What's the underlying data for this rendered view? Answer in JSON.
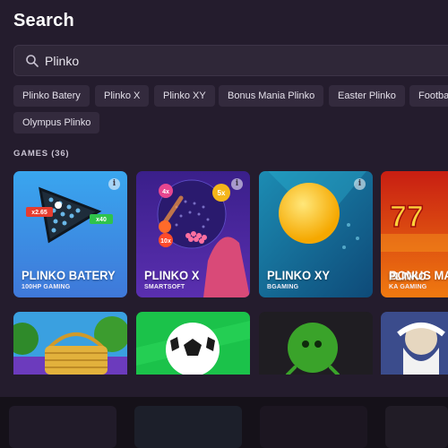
{
  "page": {
    "title": "Search"
  },
  "search": {
    "value": "Plinko",
    "icon": "search-icon"
  },
  "chips": [
    {
      "label": "Plinko Batery"
    },
    {
      "label": "Plinko X"
    },
    {
      "label": "Plinko XY"
    },
    {
      "label": "Bonus Mania Plinko"
    },
    {
      "label": "Easter Plinko"
    },
    {
      "label": "Footba"
    },
    {
      "label": "Olympus Plinko"
    }
  ],
  "games": {
    "label": "GAMES (36)",
    "cards": [
      {
        "name": "PLINKO BATERY",
        "provider": "100HP GAMING",
        "badges": [
          "x2.65",
          "x40"
        ]
      },
      {
        "name": "PLINKO X",
        "provider": "SMARTSOFT",
        "badges": [
          "4x",
          "5x",
          "10x"
        ]
      },
      {
        "name": "PLINKO XY",
        "provider": "BGAMING"
      },
      {
        "name": "BONUS MA",
        "subname": "PLINKO",
        "provider": "KA GAMING"
      }
    ]
  },
  "colors": {
    "panel": "#241c2d",
    "chip": "#332a3d",
    "search": "#2f2738"
  }
}
